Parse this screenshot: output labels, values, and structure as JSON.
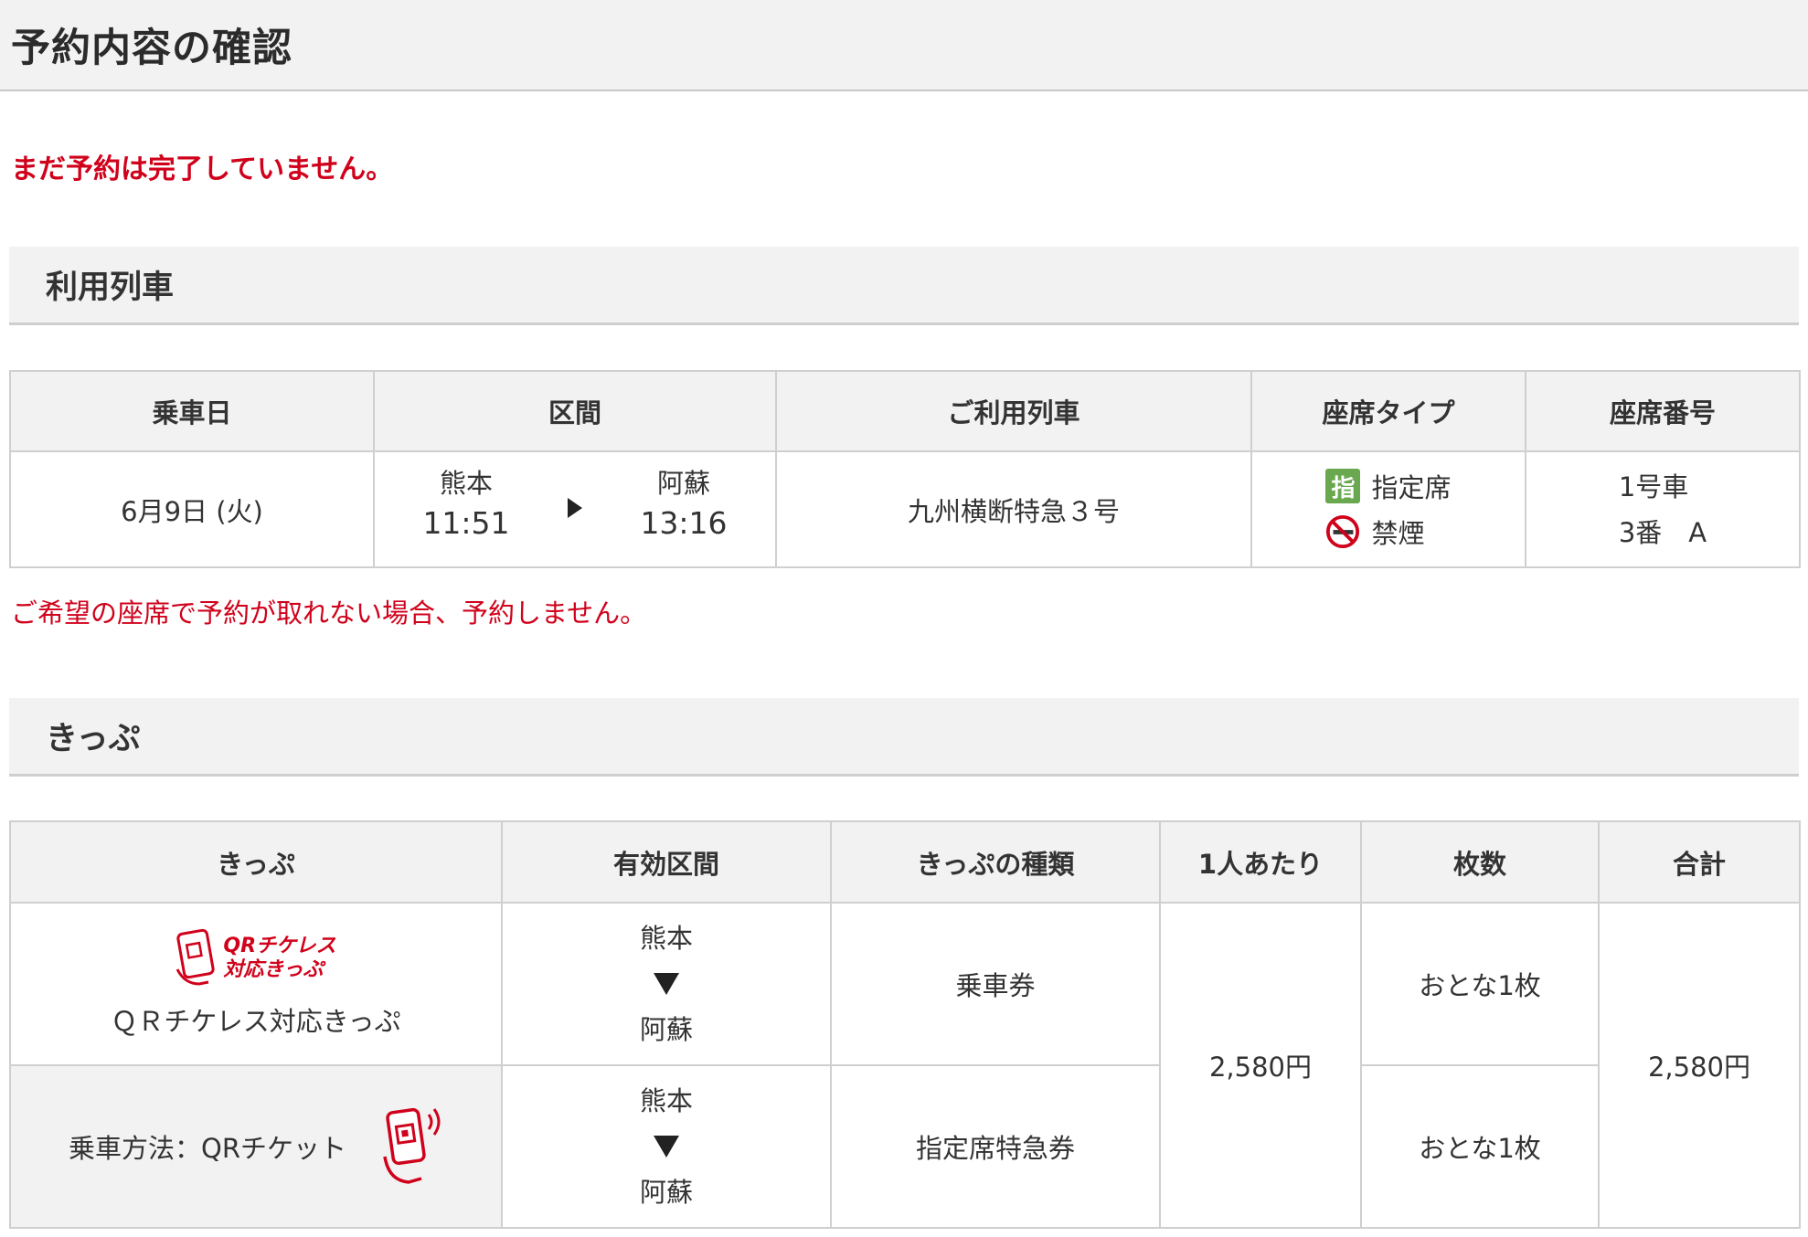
{
  "page": {
    "title": "予約内容の確認",
    "warning": "まだ予約は完了していません。"
  },
  "train_section": {
    "heading": "利用列車",
    "columns": [
      "乗車日",
      "区間",
      "ご利用列車",
      "座席タイプ",
      "座席番号"
    ],
    "row": {
      "date": "6月9日 (火)",
      "from_station": "熊本",
      "from_time": "11:51",
      "to_station": "阿蘇",
      "to_time": "13:16",
      "train": "九州横断特急３号",
      "seat_type_reserved_icon": "指",
      "seat_type_reserved": "指定席",
      "seat_type_smoking": "禁煙",
      "car": "1号車",
      "seat": "3番　A"
    },
    "note": "ご希望の座席で予約が取れない場合、予約しません。"
  },
  "ticket_section": {
    "heading": "きっぷ",
    "columns": [
      "きっぷ",
      "有効区間",
      "きっぷの種類",
      "1人あたり",
      "枚数",
      "合計"
    ],
    "qr_logo_line1": "QRチケレス",
    "qr_logo_line2": "対応きっぷ",
    "ticket_name": "ＱＲチケレス対応きっぷ",
    "ride_method": "乗車方法：QRチケット",
    "rows": [
      {
        "from": "熊本",
        "to": "阿蘇",
        "type": "乗車券",
        "count": "おとな1枚"
      },
      {
        "from": "熊本",
        "to": "阿蘇",
        "type": "指定席特急券",
        "count": "おとな1枚"
      }
    ],
    "per_person": "2,580円",
    "total": "2,580円"
  },
  "colors": {
    "accent_red": "#d0021b",
    "header_gray": "#f2f2f2",
    "border_gray": "#cfcfcf",
    "reserved_green": "#6aa84f"
  },
  "icons": [
    "reserved-seat-icon",
    "no-smoking-icon",
    "play-arrow-icon",
    "down-arrow-icon",
    "qr-ticketless-logo-icon",
    "qr-phone-icon"
  ]
}
